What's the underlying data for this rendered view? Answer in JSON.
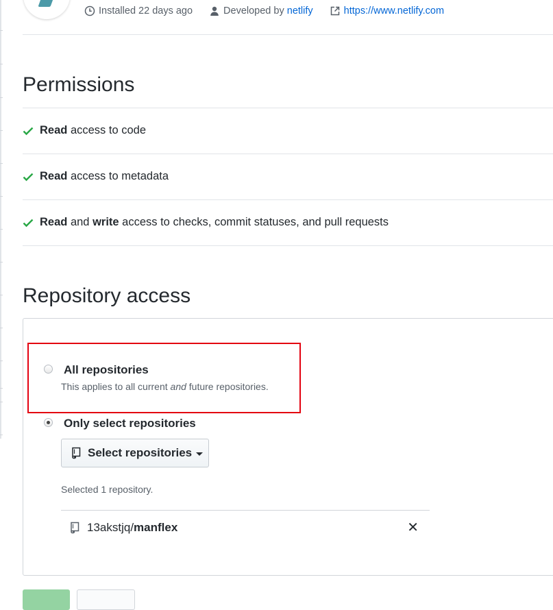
{
  "app_meta": {
    "installed": "Installed 22 days ago",
    "developed_prefix": "Developed by",
    "developer": "netlify",
    "website": "https://www.netlify.com"
  },
  "permissions": {
    "title": "Permissions",
    "items": [
      {
        "bold1": "Read",
        "middle": "",
        "bold2": "",
        "rest": " access to code"
      },
      {
        "bold1": "Read",
        "middle": "",
        "bold2": "",
        "rest": " access to metadata"
      },
      {
        "bold1": "Read",
        "middle": " and ",
        "bold2": "write",
        "rest": " access to checks, commit statuses, and pull requests"
      }
    ]
  },
  "repo_access": {
    "title": "Repository access",
    "all": {
      "label": "All repositories",
      "desc_before": "This applies to all current ",
      "desc_em": "and",
      "desc_after": " future repositories.",
      "checked": false
    },
    "select": {
      "label": "Only select repositories",
      "checked": true,
      "button_label": "Select repositories",
      "selected_count_text": "Selected 1 repository.",
      "repo_owner": "13akstjq/",
      "repo_name": "manflex",
      "remove_symbol": "✕"
    }
  },
  "colors": {
    "accent_link": "#0366d6",
    "check": "#28a745",
    "highlight": "#e3000f"
  },
  "icons": [
    "clock-icon",
    "person-icon",
    "external-link-icon",
    "check-icon",
    "repo-icon",
    "close-icon"
  ]
}
